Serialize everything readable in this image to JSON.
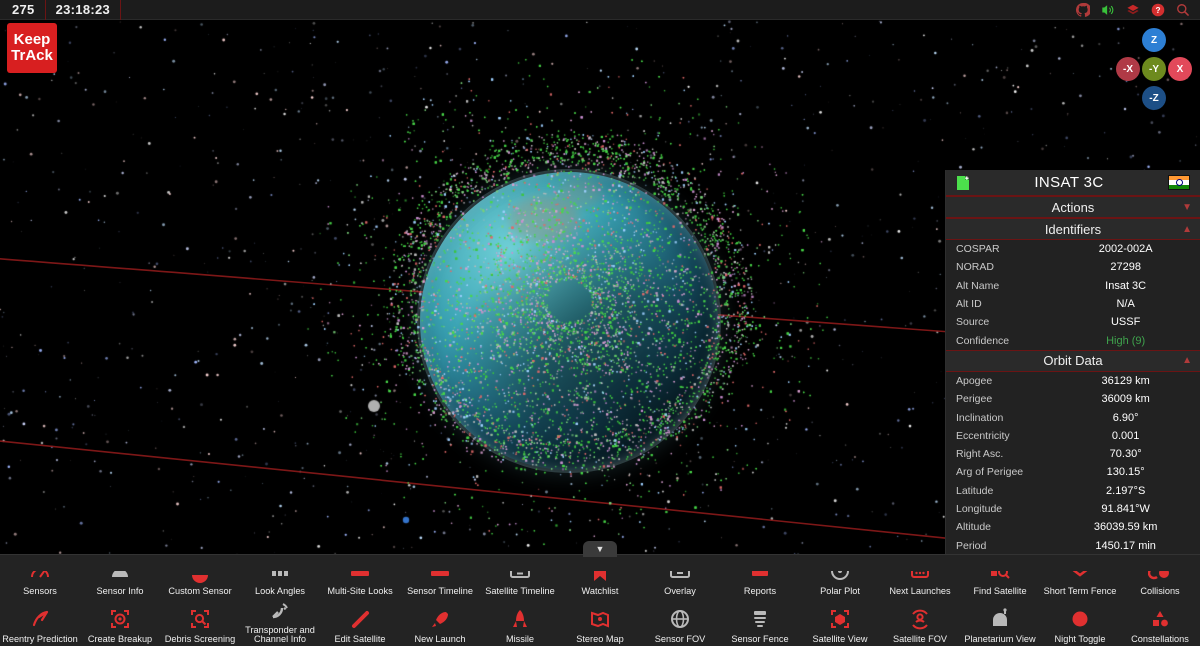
{
  "header": {
    "day_of_year": "275",
    "time": "23:18:23",
    "icons": [
      {
        "name": "github-icon",
        "label": "GitHub"
      },
      {
        "name": "sound-icon",
        "label": "Sound"
      },
      {
        "name": "layers-icon",
        "label": "Layers"
      },
      {
        "name": "help-icon",
        "label": "Help"
      },
      {
        "name": "search-icon",
        "label": "Search"
      }
    ]
  },
  "logo": {
    "line1": "Keep",
    "line2": "TrAck"
  },
  "gizmo": {
    "z": "Z",
    "neg_z": "-Z",
    "neg_x": "-X",
    "x": "X",
    "neg_y": "-Y"
  },
  "satellite_panel": {
    "title": "INSAT 3C",
    "flag": "india-flag-icon",
    "note_icon": "add-note-icon",
    "sections": [
      {
        "name": "actions",
        "label": "Actions",
        "expanded": false,
        "chevron": "▼"
      },
      {
        "name": "identifiers",
        "label": "Identifiers",
        "expanded": true,
        "chevron": "▲"
      },
      {
        "name": "orbit-data",
        "label": "Orbit Data",
        "expanded": true,
        "chevron": "▲"
      }
    ],
    "identifiers": [
      {
        "key": "COSPAR",
        "value": "2002-002A"
      },
      {
        "key": "NORAD",
        "value": "27298"
      },
      {
        "key": "Alt Name",
        "value": "Insat 3C"
      },
      {
        "key": "Alt ID",
        "value": "N/A"
      },
      {
        "key": "Source",
        "value": "USSF"
      },
      {
        "key": "Confidence",
        "value": "High (9)",
        "status": "good"
      }
    ],
    "orbit_data": [
      {
        "key": "Apogee",
        "value": "36129 km"
      },
      {
        "key": "Perigee",
        "value": "36009 km"
      },
      {
        "key": "Inclination",
        "value": "6.90°"
      },
      {
        "key": "Eccentricity",
        "value": "0.001"
      },
      {
        "key": "Right Asc.",
        "value": "70.30°"
      },
      {
        "key": "Arg of Perigee",
        "value": "130.15°"
      },
      {
        "key": "Latitude",
        "value": "2.197°S"
      },
      {
        "key": "Longitude",
        "value": "91.841°W"
      },
      {
        "key": "Altitude",
        "value": "36039.59 km"
      },
      {
        "key": "Period",
        "value": "1450.17 min"
      }
    ]
  },
  "bottom_toolbar": {
    "collapse_icon": "chevron-down-icon",
    "row_top": [
      {
        "label": "Sensors",
        "icon": "radar-sensors-icon"
      },
      {
        "label": "Sensor Info",
        "icon": "sensor-info-icon"
      },
      {
        "label": "Custom Sensor",
        "icon": "custom-sensor-icon"
      },
      {
        "label": "Look Angles",
        "icon": "look-angles-icon"
      },
      {
        "label": "Multi-Site Looks",
        "icon": "multi-site-looks-icon"
      },
      {
        "label": "Sensor Timeline",
        "icon": "sensor-timeline-icon"
      },
      {
        "label": "Satellite Timeline",
        "icon": "satellite-timeline-icon"
      },
      {
        "label": "Watchlist",
        "icon": "watchlist-icon"
      },
      {
        "label": "Overlay",
        "icon": "overlay-icon"
      },
      {
        "label": "Reports",
        "icon": "reports-icon"
      },
      {
        "label": "Polar Plot",
        "icon": "polar-plot-icon"
      },
      {
        "label": "Next Launches",
        "icon": "next-launches-icon"
      },
      {
        "label": "Find Satellite",
        "icon": "find-satellite-icon"
      },
      {
        "label": "Short Term Fence",
        "icon": "short-term-fence-icon"
      },
      {
        "label": "Collisions",
        "icon": "collisions-icon"
      }
    ],
    "row_bottom": [
      {
        "label": "Reentry Prediction",
        "icon": "reentry-prediction-icon"
      },
      {
        "label": "Create Breakup",
        "icon": "create-breakup-icon"
      },
      {
        "label": "Debris Screening",
        "icon": "debris-screening-icon"
      },
      {
        "label": "Transponder and Channel Info",
        "icon": "transponder-icon"
      },
      {
        "label": "Edit Satellite",
        "icon": "edit-satellite-icon"
      },
      {
        "label": "New Launch",
        "icon": "new-launch-icon"
      },
      {
        "label": "Missile",
        "icon": "missile-icon"
      },
      {
        "label": "Stereo Map",
        "icon": "stereo-map-icon"
      },
      {
        "label": "Sensor FOV",
        "icon": "sensor-fov-icon"
      },
      {
        "label": "Sensor Fence",
        "icon": "sensor-fence-icon"
      },
      {
        "label": "Satellite View",
        "icon": "satellite-view-icon"
      },
      {
        "label": "Satellite FOV",
        "icon": "satellite-fov-icon"
      },
      {
        "label": "Planetarium View",
        "icon": "planetarium-view-icon"
      },
      {
        "label": "Night Toggle",
        "icon": "night-toggle-icon"
      },
      {
        "label": "Constellations",
        "icon": "constellations-icon"
      }
    ]
  },
  "colors": {
    "accent_red": "#d81f20",
    "panel_bg": "#222222",
    "debris_green": "#49d849",
    "orbit_red": "#8b1a1a",
    "earth_teal": "#3aa3b4"
  }
}
